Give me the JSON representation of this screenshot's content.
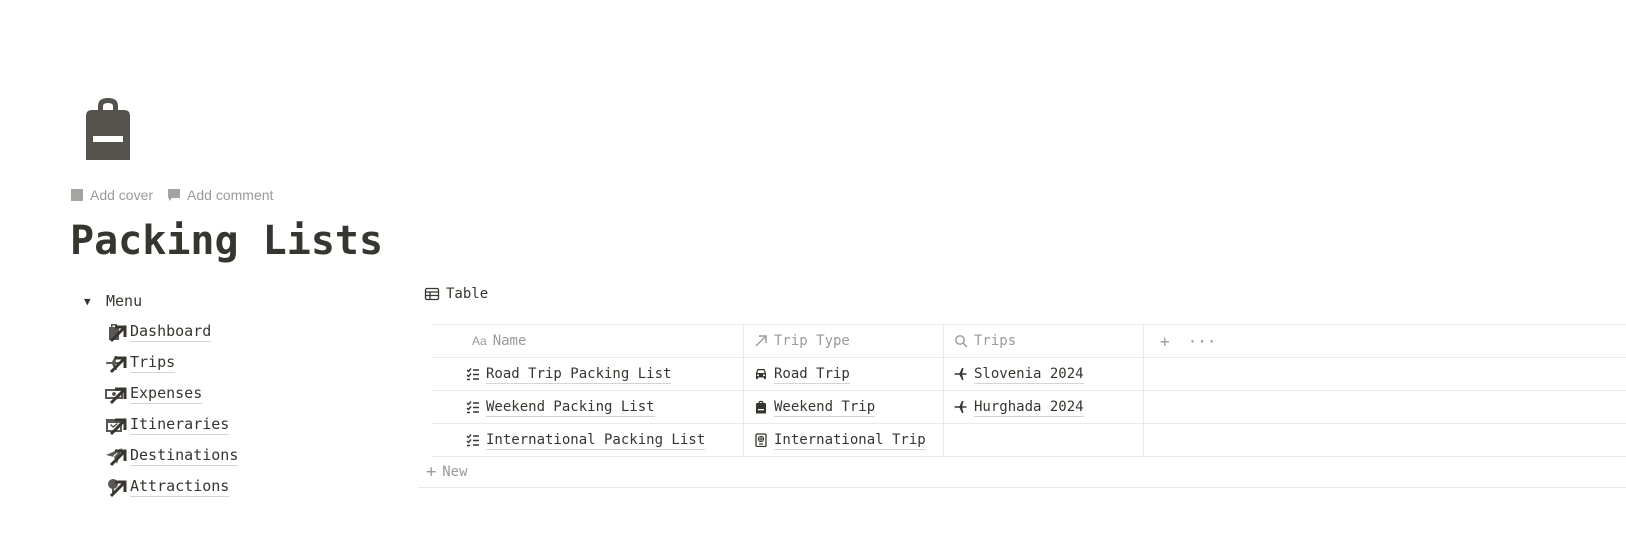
{
  "header": {
    "icon": "backpack-icon",
    "add_cover": "Add cover",
    "add_comment": "Add comment",
    "title": "Packing Lists"
  },
  "menu": {
    "toggle_label": "Menu",
    "items": [
      {
        "label": "Dashboard",
        "icon": "luggage-icon"
      },
      {
        "label": "Trips",
        "icon": "plane-icon"
      },
      {
        "label": "Expenses",
        "icon": "money-icon"
      },
      {
        "label": "Itineraries",
        "icon": "calendar-icon"
      },
      {
        "label": "Destinations",
        "icon": "paper-plane-icon"
      },
      {
        "label": "Attractions",
        "icon": "pin-icon"
      }
    ]
  },
  "table": {
    "view_label": "Table",
    "columns": [
      "Name",
      "Trip Type",
      "Trips"
    ],
    "name_prefix": "Aa",
    "rows": [
      {
        "name": "Road Trip Packing List",
        "trip_type": "Road Trip",
        "trip_type_icon": "car-icon",
        "trips": "Slovenia 2024"
      },
      {
        "name": "Weekend Packing List",
        "trip_type": "Weekend Trip",
        "trip_type_icon": "backpack-icon",
        "trips": "Hurghada 2024"
      },
      {
        "name": "International Packing List",
        "trip_type": "International Trip",
        "trip_type_icon": "passport-icon",
        "trips": ""
      }
    ],
    "new_label": "New"
  }
}
